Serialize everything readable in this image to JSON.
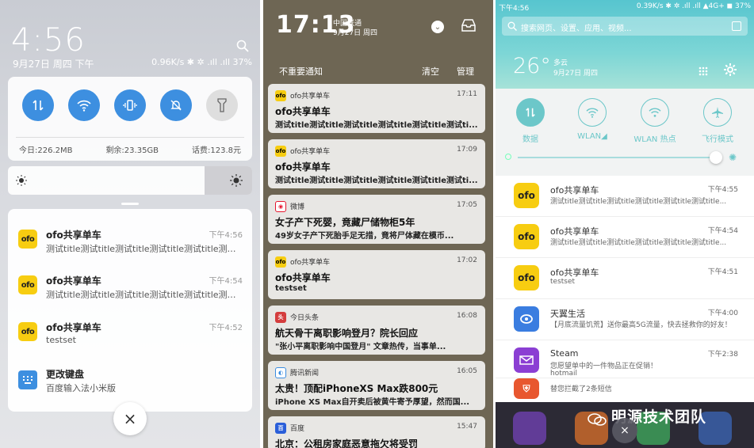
{
  "p1": {
    "clock": "4:56",
    "date": "9月27日 周四 下午",
    "status": "0.96K/s ✱ ✲ .ıll .ıll 37%",
    "usage": "今日:226.2MB",
    "remaining": "剩余:23.35GB",
    "fee": "话费:123.8元",
    "notifications": [
      {
        "title": "ofo共享单车",
        "body": "测试title测试title测试title测试title测试title测试title...",
        "time": "下午4:56",
        "icon": "ofo"
      },
      {
        "title": "ofo共享单车",
        "body": "测试title测试title测试title测试title测试title测试title...",
        "time": "下午4:54",
        "icon": "ofo"
      },
      {
        "title": "ofo共享单车",
        "body": "testset",
        "time": "下午4:52",
        "icon": "ofo"
      },
      {
        "title": "更改键盘",
        "body": "百度输入法小米版",
        "time": "",
        "icon": "keyboard"
      }
    ],
    "close_label": "×"
  },
  "p2": {
    "clock": "17:13",
    "carrier": "中国联通",
    "date": "9月27日 周四",
    "header": "不重要通知",
    "clear": "清空",
    "manage": "管理",
    "notifications": [
      {
        "app": "ofo共享单车",
        "time": "17:11",
        "title": "ofo共享单车",
        "body": "测试title测试title测试title测试title测试title测试ti...",
        "icon": "ofo",
        "color": "#f7cd11"
      },
      {
        "app": "ofo共享单车",
        "time": "17:09",
        "title": "ofo共享单车",
        "body": "测试title测试title测试title测试title测试title测试ti...",
        "icon": "ofo",
        "color": "#f7cd11"
      },
      {
        "app": "微博",
        "time": "17:05",
        "title": "女子产下死婴，竟藏尸储物柜5年",
        "body": "49岁女子产下死胎手足无措，竟将尸体藏在模币...",
        "icon": "weibo",
        "color": "#e6162d"
      },
      {
        "app": "ofo共享单车",
        "time": "17:02",
        "title": "ofo共享单车",
        "body": "testset",
        "icon": "ofo",
        "color": "#f7cd11"
      },
      {
        "app": "今日头条",
        "time": "16:08",
        "title": "航天骨干离职影响登月？院长回应",
        "body": "\"张小平离职影响中国登月\" 文章热传，当事单...",
        "icon": "toutiao",
        "color": "#d43d3d"
      },
      {
        "app": "腾讯新闻",
        "time": "16:05",
        "title": "太贵！顶配iPhoneXS Max跌800元",
        "body": "iPhone XS Max自开卖后被黄牛寄予厚望，然而国...",
        "icon": "txnews",
        "color": "#3b8de0"
      },
      {
        "app": "百度",
        "time": "15:47",
        "title": "北京：公租房家庭恶意拖欠将受罚",
        "body": "",
        "icon": "baidu",
        "color": "#2b5fd9"
      }
    ]
  },
  "p3": {
    "status_left": "下午4:56",
    "status_right": "0.39K/s ✱ ✲ .ıll .ıll ▲4G+ ◼ 37%",
    "search_placeholder": "搜索网页、设置、应用、视频...",
    "temp": "26°",
    "condition": "多云",
    "date": "9月27日 周四",
    "toggles": [
      {
        "label": "数据",
        "icon": "data-icon",
        "on": true
      },
      {
        "label": "WLAN◢",
        "icon": "wifi-icon",
        "on": false
      },
      {
        "label": "WLAN 热点",
        "icon": "hotspot-icon",
        "on": false
      },
      {
        "label": "飞行模式",
        "icon": "airplane-icon",
        "on": false
      }
    ],
    "notifications": [
      {
        "title": "ofo共享单车",
        "body": "测试title测试title测试title测试title测试title测试title...",
        "time": "下午4:55",
        "icon": "ofo"
      },
      {
        "title": "ofo共享单车",
        "body": "测试title测试title测试title测试title测试title测试title...",
        "time": "下午4:54",
        "icon": "ofo"
      },
      {
        "title": "ofo共享单车",
        "body": "testset",
        "time": "下午4:51",
        "icon": "ofo"
      },
      {
        "title": "天翼生活",
        "body": "【月底流量饥荒】送你最高5G流量，快去拯救你的好友！",
        "time": "下午4:00",
        "icon": "tianyi"
      },
      {
        "title": "Steam",
        "body": "您愿望单中的一件物品正在促销！",
        "body2": "hotmail",
        "time": "下午2:38",
        "icon": "steam"
      },
      {
        "title": "",
        "body": "替您拦截了2条短信",
        "time": "",
        "icon": "shield"
      }
    ],
    "watermark": "明源技术团队",
    "close_label": "×"
  }
}
